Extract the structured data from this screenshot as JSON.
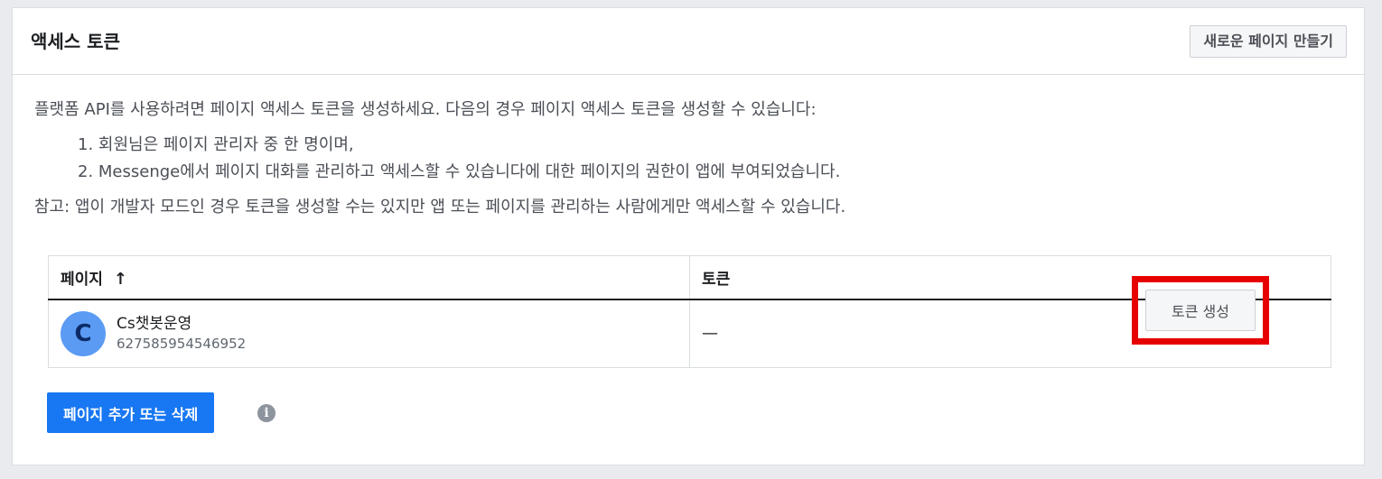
{
  "panel": {
    "title": "액세스 토큰",
    "create_page_button": "새로운 페이지 만들기"
  },
  "intro": {
    "text": "플랫폼 API를 사용하려면 페이지 액세스 토큰을 생성하세요. 다음의 경우 페이지 액세스 토큰을 생성할 수 있습니다:",
    "conditions": [
      "1. 회원님은 페이지 관리자 중 한 명이며,",
      "2. Messenge에서 페이지 대화를 관리하고 액세스할 수 있습니다에 대한 페이지의 권한이 앱에 부여되었습니다."
    ],
    "note": "참고: 앱이 개발자 모드인 경우 토큰을 생성할 수는 있지만 앱 또는 페이지를 관리하는 사람에게만 액세스할 수 있습니다."
  },
  "table": {
    "columns": {
      "page": "페이지",
      "page_sort_icon": "arrow-up-icon",
      "token": "토큰"
    },
    "rows": [
      {
        "avatar_letter": "C",
        "page_name": "Cs챗봇운영",
        "page_id": "627585954546952",
        "token": "—",
        "generate_button": "토큰 생성"
      }
    ]
  },
  "footer": {
    "manage_pages_button": "페이지 추가 또는 삭제",
    "info_icon": "info-icon",
    "info_glyph": "i"
  },
  "colors": {
    "primary": "#1877f2",
    "highlight_box": "#e60000",
    "avatar": "#5b9bf4"
  }
}
